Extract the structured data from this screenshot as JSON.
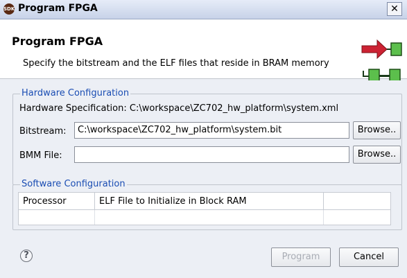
{
  "window": {
    "title": "Program FPGA",
    "app_icon_text": "SDK"
  },
  "header": {
    "title": "Program FPGA",
    "description": "Specify the bitstream and the ELF files that reside in BRAM memory"
  },
  "hardware_config": {
    "group_title": "Hardware Configuration",
    "spec_label": "Hardware Specification:",
    "spec_path": "C:\\workspace\\ZC702_hw_platform\\system.xml",
    "bitstream_label": "Bitstream:",
    "bitstream_value": "C:\\workspace\\ZC702_hw_platform\\system.bit",
    "bmm_label": "BMM File:",
    "bmm_value": "",
    "browse_label": "Browse.."
  },
  "software_config": {
    "group_title": "Software Configuration",
    "columns": [
      "Processor",
      "ELF File to Initialize in Block RAM",
      ""
    ]
  },
  "footer": {
    "help_symbol": "?",
    "program_label": "Program",
    "cancel_label": "Cancel"
  },
  "colors": {
    "group_title": "#1a4db3",
    "arrow_red": "#cc2233",
    "block_green": "#5cbf4c"
  }
}
